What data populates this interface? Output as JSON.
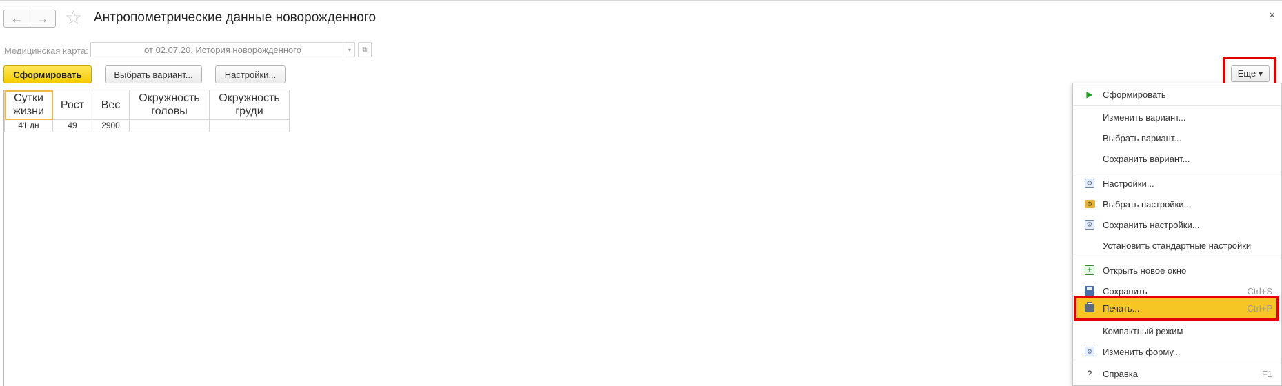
{
  "window": {
    "title": "Антропометрические данные новорожденного",
    "back_icon": "←",
    "forward_icon": "→",
    "favorite_icon": "☆",
    "close_icon": "×"
  },
  "filter": {
    "label": "Медицинская карта:",
    "value": "от 02.07.20, История новорожденного",
    "dropdown_icon": "▾",
    "open_icon": "⧉"
  },
  "toolbar": {
    "generate": "Сформировать",
    "choose_variant": "Выбрать вариант...",
    "settings": "Настройки...",
    "more": "Еще ▾"
  },
  "report": {
    "headers": [
      "Сутки жизни",
      "Рост",
      "Вес",
      "Окружность головы",
      "Окружность груди"
    ],
    "rows": [
      [
        "41 дн",
        "49",
        "2900",
        "",
        ""
      ]
    ]
  },
  "menu": {
    "items": [
      {
        "label": "Сформировать",
        "icon": "play-icon",
        "shortcut": ""
      },
      {
        "label": "Изменить вариант...",
        "icon": "",
        "shortcut": ""
      },
      {
        "label": "Выбрать вариант...",
        "icon": "",
        "shortcut": ""
      },
      {
        "label": "Сохранить вариант...",
        "icon": "",
        "shortcut": ""
      },
      {
        "label": "Настройки...",
        "icon": "settings-icon",
        "shortcut": ""
      },
      {
        "label": "Выбрать настройки...",
        "icon": "folder-settings-icon",
        "shortcut": ""
      },
      {
        "label": "Сохранить настройки...",
        "icon": "save-settings-icon",
        "shortcut": ""
      },
      {
        "label": "Установить стандартные настройки",
        "icon": "",
        "shortcut": ""
      },
      {
        "label": "Открыть новое окно",
        "icon": "new-window-icon",
        "shortcut": ""
      },
      {
        "label": "Сохранить",
        "icon": "save-icon",
        "shortcut": "Ctrl+S"
      },
      {
        "label": "Печать...",
        "icon": "print-icon",
        "shortcut": "Ctrl+P"
      },
      {
        "label": "Компактный режим",
        "icon": "",
        "shortcut": ""
      },
      {
        "label": "Изменить форму...",
        "icon": "form-icon",
        "shortcut": ""
      },
      {
        "label": "Справка",
        "icon": "help-icon",
        "shortcut": "F1"
      }
    ],
    "play_glyph": "▶",
    "help_glyph": "?",
    "new_glyph": "+",
    "gear_glyph": "⚙"
  },
  "colors": {
    "primary_button": "#f5cc00",
    "highlight": "#e00000",
    "menu_active": "#f6c624"
  }
}
